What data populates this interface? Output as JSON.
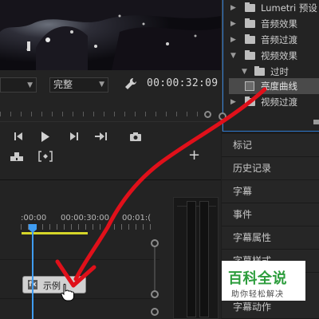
{
  "program_monitor": {
    "quality": "完整",
    "timecode": "00:00:32:09"
  },
  "timeline": {
    "ruler_timecodes": [
      ":00:00",
      "00:00:30:00",
      "00:01:("
    ],
    "clip_label": "示例"
  },
  "effects_tree": [
    {
      "label": "Lumetri 预设",
      "expanded": false
    },
    {
      "label": "音频效果",
      "expanded": false
    },
    {
      "label": "音频过渡",
      "expanded": false
    },
    {
      "label": "视频效果",
      "expanded": true
    },
    {
      "label": "过时",
      "expanded": true
    },
    {
      "label": "亮度曲线",
      "selected": true
    },
    {
      "label": "视频过渡",
      "expanded": false
    }
  ],
  "panels": [
    "标记",
    "历史记录",
    "字幕",
    "事件",
    "字幕属性",
    "字幕样式",
    "字幕动作"
  ],
  "watermark": {
    "title": "百科全说",
    "subtitle": "助你轻松解决"
  },
  "colors": {
    "accent_blue": "#3f9cf2",
    "work_area": "#d6d62a",
    "annotation_red": "#e0101a",
    "watermark_green": "#2c9d3c"
  }
}
